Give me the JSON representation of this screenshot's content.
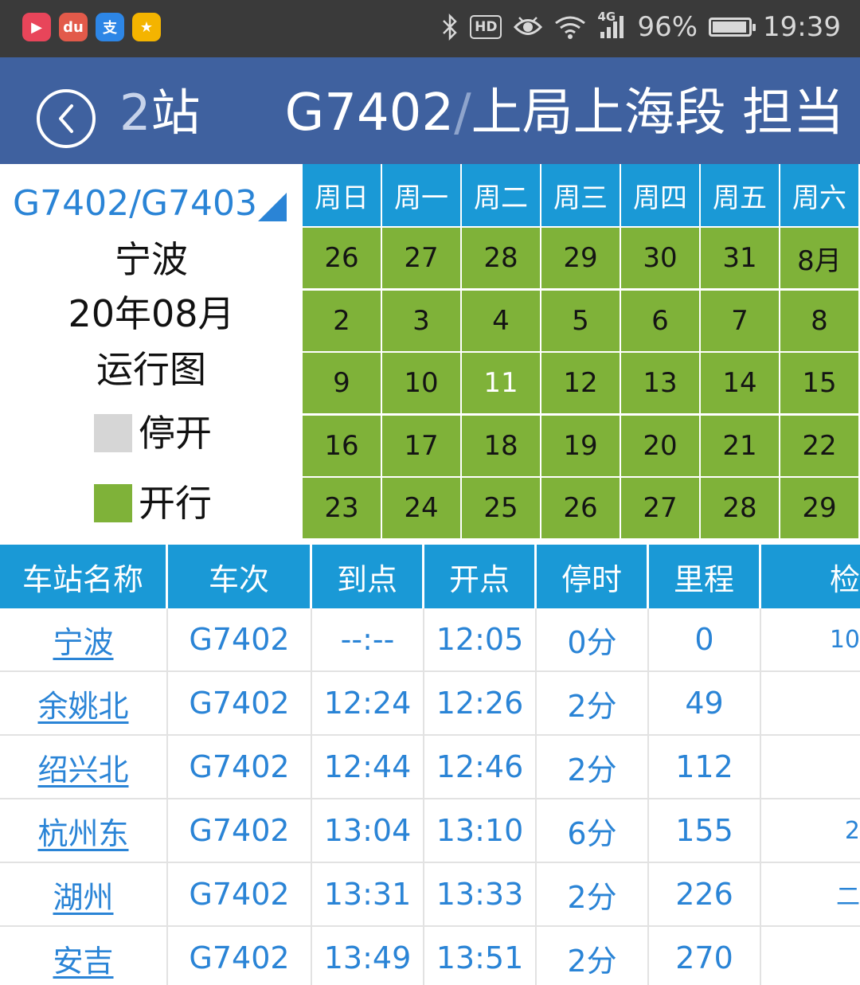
{
  "status_bar": {
    "apps": [
      {
        "name": "video-app-icon",
        "glyph": "▶",
        "color": "#e8455a"
      },
      {
        "name": "du-map-app-icon",
        "glyph": "du",
        "color": "#e25a4a"
      },
      {
        "name": "alipay-app-icon",
        "glyph": "支",
        "color": "#2d86e6"
      },
      {
        "name": "star-app-icon",
        "glyph": "★",
        "color": "#f4b400"
      }
    ],
    "hd_label": "HD",
    "network_label": "4G",
    "battery": "96%",
    "battery_level": 0.96,
    "time": "19:39"
  },
  "header": {
    "stop_count_num": "2",
    "stop_count_unit": "站",
    "train_no": "G7402",
    "slash": "/",
    "bureau": "上局上海段 担当"
  },
  "info": {
    "train_select": "G7402/G7403",
    "station": "宁波",
    "month": "20年08月",
    "chart_label": "运行图",
    "legend": [
      {
        "label": "停开",
        "color": "#d6d6d6"
      },
      {
        "label": "开行",
        "color": "#7fb239"
      }
    ]
  },
  "calendar": {
    "weekdays": [
      "周日",
      "周一",
      "周二",
      "周三",
      "周四",
      "周五",
      "周六"
    ],
    "weeks": [
      [
        "26",
        "27",
        "28",
        "29",
        "30",
        "31",
        "8月"
      ],
      [
        "2",
        "3",
        "4",
        "5",
        "6",
        "7",
        "8"
      ],
      [
        "9",
        "10",
        "11",
        "12",
        "13",
        "14",
        "15"
      ],
      [
        "16",
        "17",
        "18",
        "19",
        "20",
        "21",
        "22"
      ],
      [
        "23",
        "24",
        "25",
        "26",
        "27",
        "28",
        "29"
      ]
    ],
    "today": "11",
    "running_color": "#7fb239",
    "stopped_color": "#d6d6d6"
  },
  "schedule": {
    "columns": [
      "车站名称",
      "车次",
      "到点",
      "开点",
      "停时",
      "里程",
      "检"
    ],
    "rows": [
      {
        "station": "宁波",
        "train": "G7402",
        "arrive": "--:--",
        "depart": "12:05",
        "stop": "0分",
        "distance": "0",
        "gate": "10"
      },
      {
        "station": "余姚北",
        "train": "G7402",
        "arrive": "12:24",
        "depart": "12:26",
        "stop": "2分",
        "distance": "49",
        "gate": ""
      },
      {
        "station": "绍兴北",
        "train": "G7402",
        "arrive": "12:44",
        "depart": "12:46",
        "stop": "2分",
        "distance": "112",
        "gate": ""
      },
      {
        "station": "杭州东",
        "train": "G7402",
        "arrive": "13:04",
        "depart": "13:10",
        "stop": "6分",
        "distance": "155",
        "gate": "2"
      },
      {
        "station": "湖州",
        "train": "G7402",
        "arrive": "13:31",
        "depart": "13:33",
        "stop": "2分",
        "distance": "226",
        "gate": "二"
      },
      {
        "station": "安吉",
        "train": "G7402",
        "arrive": "13:49",
        "depart": "13:51",
        "stop": "2分",
        "distance": "270",
        "gate": ""
      }
    ]
  }
}
